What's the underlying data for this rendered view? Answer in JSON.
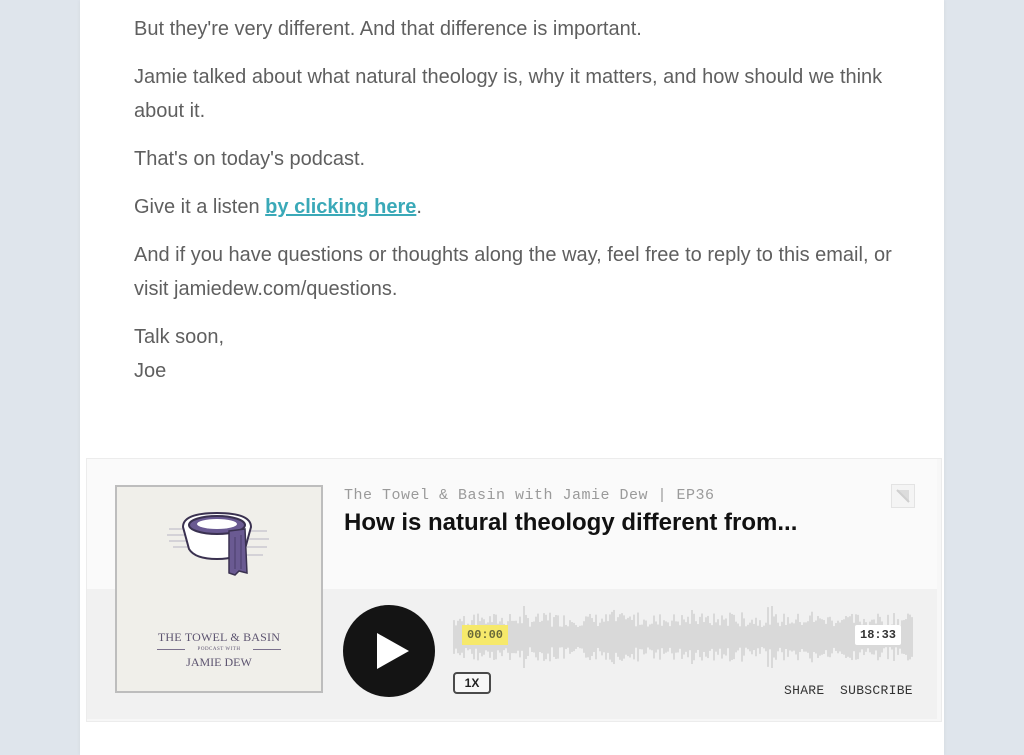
{
  "email": {
    "paragraphs": [
      "But they're very different. And that difference is important.",
      "Jamie talked about what natural theology is, why it matters, and how should we think about it.",
      "That's on today's podcast."
    ],
    "listen_prefix": "Give it a listen ",
    "listen_link": "by clicking here",
    "listen_suffix": ".",
    "questions": "And if you have questions or thoughts along the way, feel free to reply to this email, or visit jamiedew.com/questions.",
    "signoff": "Talk soon,",
    "signature": "Joe",
    "link_color": "#3aa9b8"
  },
  "player": {
    "artwork": {
      "title": "THE TOWEL & BASIN",
      "subtitle": "PODCAST WITH",
      "host": "JAMIE DEW",
      "icon": "towel-basin-icon"
    },
    "show_line": "The Towel & Basin with Jamie Dew | EP36",
    "episode_title": "How is natural theology different from...",
    "current_time": "00:00",
    "total_time": "18:33",
    "progress": 0,
    "speed": "1X",
    "share_label": "SHARE",
    "subscribe_label": "SUBSCRIBE",
    "play_icon": "play-icon",
    "external_icon": "open-external-icon"
  }
}
